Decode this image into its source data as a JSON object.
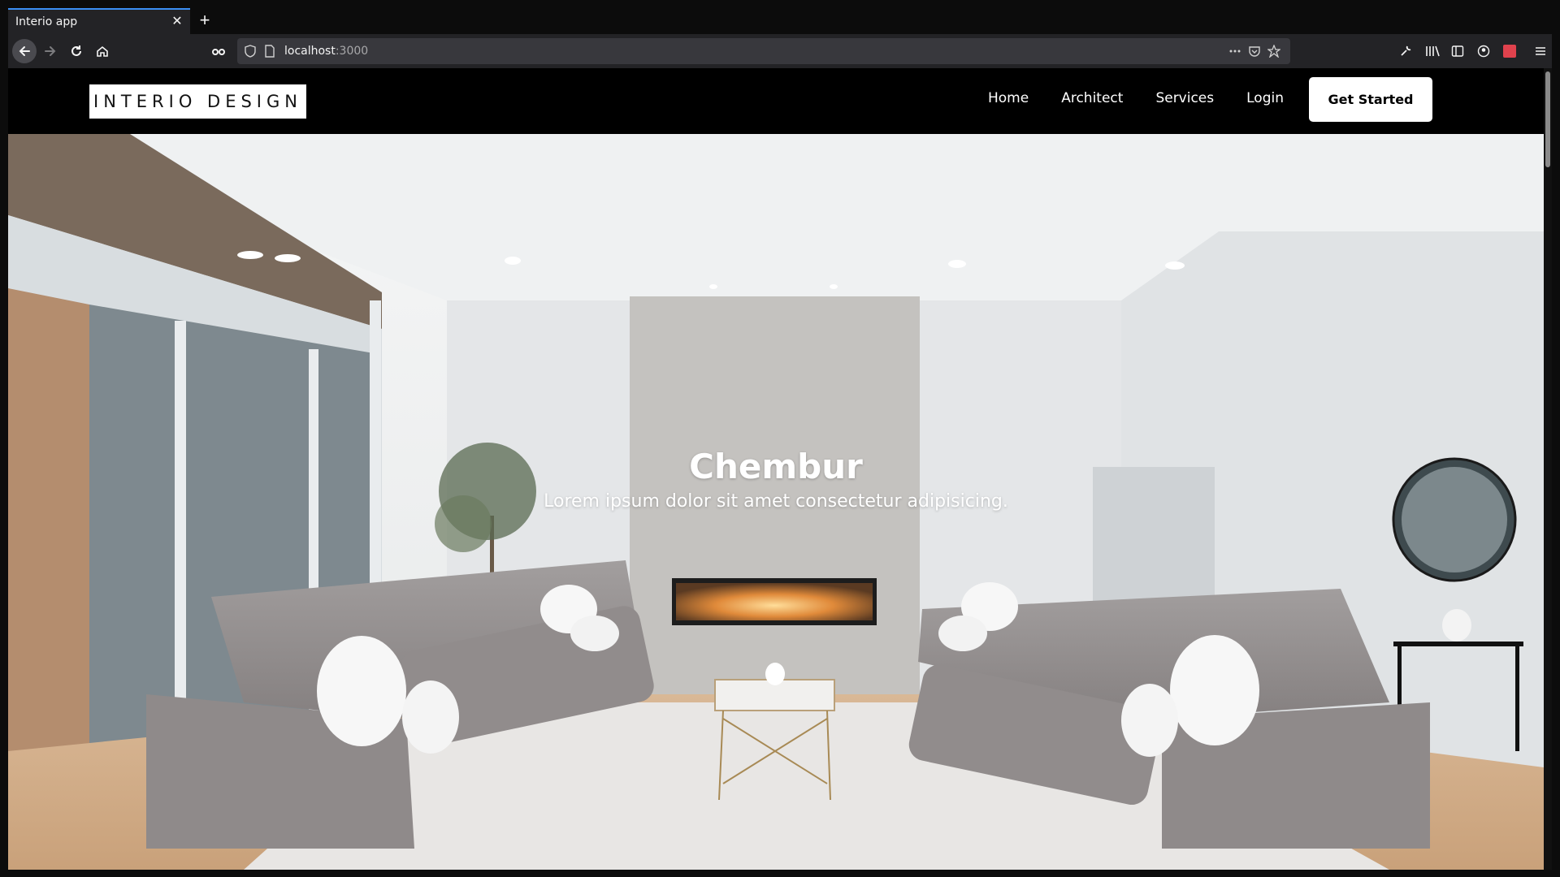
{
  "browser": {
    "tab_title": "Interio app",
    "url_host": "localhost",
    "url_port": ":3000"
  },
  "navbar": {
    "logo": "INTERIO DESIGN",
    "links": [
      "Home",
      "Architect",
      "Services",
      "Login"
    ],
    "cta": "Get Started"
  },
  "hero": {
    "title": "Chembur",
    "subtitle": "Lorem ipsum dolor sit amet consectetur adipisicing."
  },
  "icons": {
    "back": "arrow-left-icon",
    "forward": "arrow-right-icon",
    "reload": "reload-icon",
    "home": "home-icon",
    "shield": "shield-icon",
    "page": "page-icon",
    "more": "more-icon",
    "pocket": "pocket-icon",
    "star": "star-icon",
    "menu": "hamburger-icon"
  }
}
